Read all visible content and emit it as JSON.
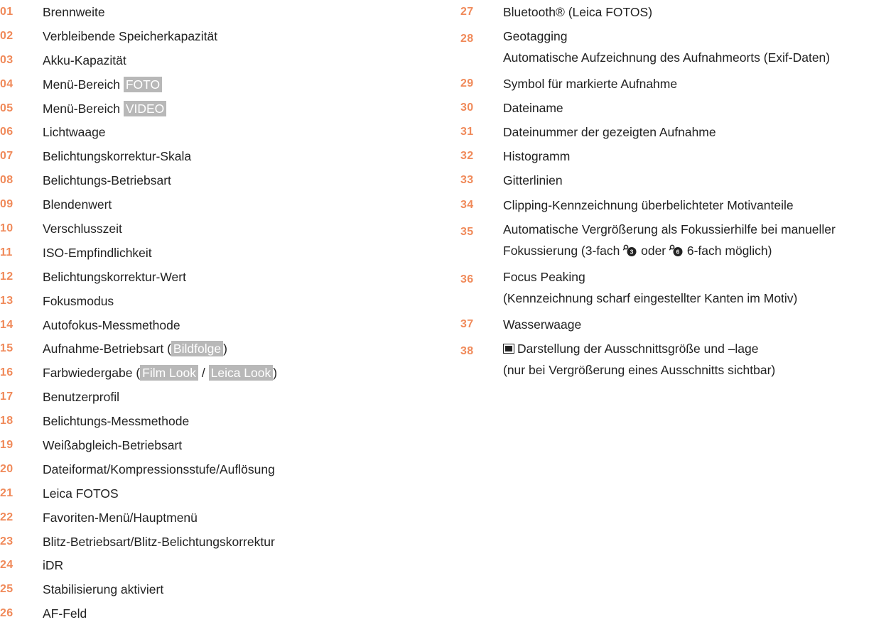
{
  "left_items": [
    {
      "num": "01",
      "label": "Brennweite"
    },
    {
      "num": "02",
      "label": "Verbleibende Speicherkapazität"
    },
    {
      "num": "03",
      "label": "Akku-Kapazität"
    },
    {
      "num": "04",
      "label": "Menü-Bereich ",
      "tag": "FOTO"
    },
    {
      "num": "05",
      "label": "Menü-Bereich ",
      "tag": "VIDEO"
    },
    {
      "num": "06",
      "label": "Lichtwaage"
    },
    {
      "num": "07",
      "label": "Belichtungskorrektur-Skala"
    },
    {
      "num": "08",
      "label": "Belichtungs-Betriebsart"
    },
    {
      "num": "09",
      "label": "Blendenwert"
    },
    {
      "num": "10",
      "label": "Verschlusszeit"
    },
    {
      "num": "11",
      "label": "ISO-Empfindlichkeit"
    },
    {
      "num": "12",
      "label": "Belichtungskorrektur-Wert"
    },
    {
      "num": "13",
      "label": "Fokusmodus"
    },
    {
      "num": "14",
      "label": "Autofokus-Messmethode"
    },
    {
      "num": "15",
      "label": "Aufnahme-Betriebsart (",
      "tag": "Bildfolge",
      "suffix": ")"
    },
    {
      "num": "16",
      "label": "Farbwiedergabe (",
      "tag": "Film Look",
      "mid": " / ",
      "tag2": "Leica Look",
      "suffix": ")"
    },
    {
      "num": "17",
      "label": "Benutzerprofil"
    },
    {
      "num": "18",
      "label": "Belichtungs-Messmethode"
    },
    {
      "num": "19",
      "label": "Weißabgleich-Betriebsart"
    },
    {
      "num": "20",
      "label": "Dateiformat/Kompressionsstufe/Auflösung"
    },
    {
      "num": "21",
      "label": "Leica FOTOS"
    },
    {
      "num": "22",
      "label": "Favoriten-Menü/Hauptmenü"
    },
    {
      "num": "23",
      "label": "Blitz-Betriebsart/Blitz-Belichtungskorrektur"
    },
    {
      "num": "24",
      "label": "iDR"
    },
    {
      "num": "25",
      "label": "Stabilisierung aktiviert"
    },
    {
      "num": "26",
      "label": "AF-Feld"
    }
  ],
  "right_items": {
    "i27": {
      "num": "27",
      "label": "Bluetooth® (Leica FOTOS)"
    },
    "i28": {
      "num": "28",
      "line1": "Geotagging",
      "line2": "Automatische Aufzeichnung des Aufnahmeorts (Exif-Daten)"
    },
    "i29": {
      "num": "29",
      "label": "Symbol für markierte Aufnahme"
    },
    "i30": {
      "num": "30",
      "label": "Dateiname"
    },
    "i31": {
      "num": "31",
      "label": "Dateinummer der gezeigten Aufnahme"
    },
    "i32": {
      "num": "32",
      "label": "Histogramm"
    },
    "i33": {
      "num": "33",
      "label": "Gitterlinien"
    },
    "i34": {
      "num": "34",
      "label": "Clipping-Kennzeichnung überbelichteter Motivanteile"
    },
    "i35": {
      "num": "35",
      "line1": "Automatische Vergrößerung als Fokussierhilfe bei manueller",
      "line2a": "Fokussierung (3-fach ",
      "line2b": " oder ",
      "line2c": " 6-fach möglich)",
      "icon1": "zoom-3x-icon",
      "icon2": "zoom-6x-icon"
    },
    "i36": {
      "num": "36",
      "line1": "Focus Peaking",
      "line2": "(Kennzeichnung scharf eingestellter Kanten im Motiv)"
    },
    "i37": {
      "num": "37",
      "label": "Wasserwaage"
    },
    "i38": {
      "num": "38",
      "line1": "Darstellung der Ausschnittsgröße und –lage",
      "line2": "(nur bei Vergrößerung eines Ausschnitts sichtbar)",
      "icon": "frame-position-icon"
    }
  },
  "colors": {
    "number_accent": "#f08a5a",
    "tag_background": "#b8b8b8"
  }
}
